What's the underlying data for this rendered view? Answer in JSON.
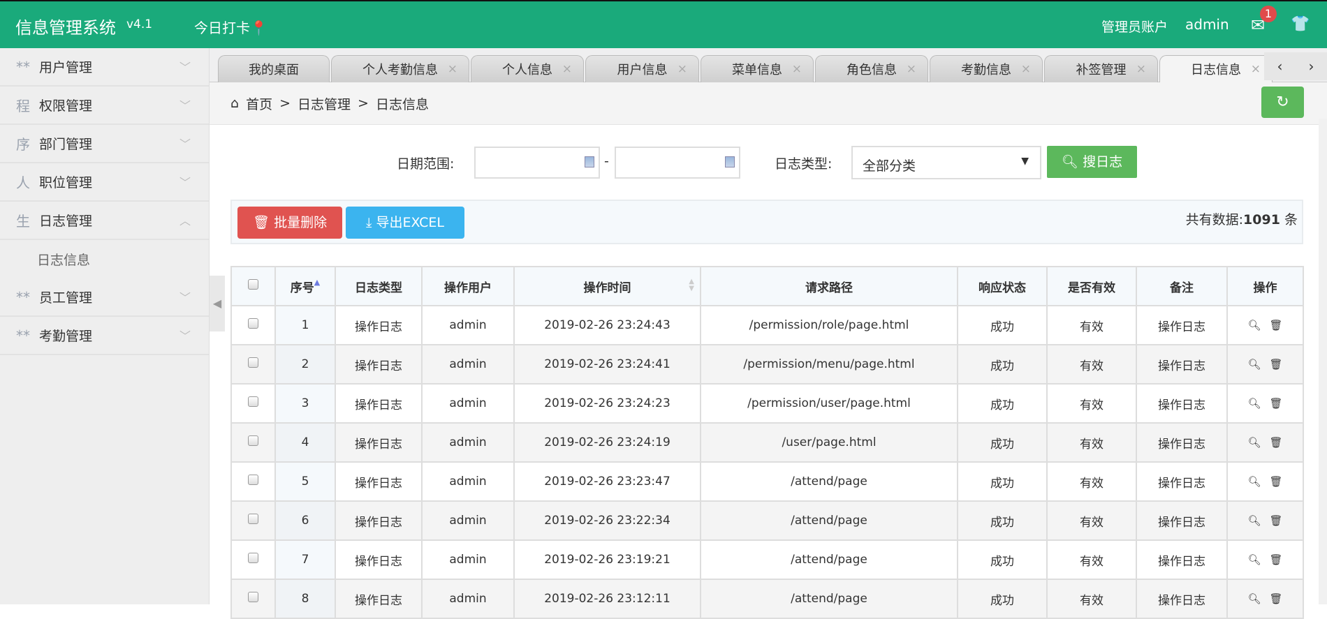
{
  "header": {
    "title": "信息管理系统",
    "version": "v4.1",
    "punch": "今日打卡",
    "account_label": "管理员账户",
    "username": "admin",
    "mail_badge": "1"
  },
  "sidebar": {
    "items": [
      {
        "icon": "**",
        "label": "用户管理",
        "chevron": "﹀"
      },
      {
        "icon": "程",
        "label": "权限管理",
        "chevron": "﹀"
      },
      {
        "icon": "序",
        "label": "部门管理",
        "chevron": "﹀"
      },
      {
        "icon": "人",
        "label": "职位管理",
        "chevron": "﹀"
      },
      {
        "icon": "生",
        "label": "日志管理",
        "chevron": "︿"
      }
    ],
    "sub": "日志信息",
    "items2": [
      {
        "icon": "**",
        "label": "员工管理",
        "chevron": "﹀"
      },
      {
        "icon": "**",
        "label": "考勤管理",
        "chevron": "﹀"
      }
    ]
  },
  "tabs": [
    "我的桌面",
    "个人考勤信息",
    "个人信息",
    "用户信息",
    "菜单信息",
    "角色信息",
    "考勤信息",
    "补签管理",
    "日志信息"
  ],
  "breadcrumb": [
    "首页",
    ">",
    "日志管理",
    ">",
    "日志信息"
  ],
  "search": {
    "date_label": "日期范围:",
    "date_sep": "-",
    "type_label": "日志类型:",
    "type_value": "全部分类",
    "button": "搜日志"
  },
  "toolbar": {
    "delete": "批量删除",
    "export": "导出EXCEL",
    "total_prefix": "共有数据:",
    "total": "1091",
    "total_suffix": "条"
  },
  "table": {
    "headers": [
      "序号",
      "日志类型",
      "操作用户",
      "操作时间",
      "请求路径",
      "响应状态",
      "是否有效",
      "备注",
      "操作"
    ],
    "rows": [
      [
        "1",
        "操作日志",
        "admin",
        "2019-02-26 23:24:43",
        "/permission/role/page.html",
        "成功",
        "有效",
        "操作日志"
      ],
      [
        "2",
        "操作日志",
        "admin",
        "2019-02-26 23:24:41",
        "/permission/menu/page.html",
        "成功",
        "有效",
        "操作日志"
      ],
      [
        "3",
        "操作日志",
        "admin",
        "2019-02-26 23:24:23",
        "/permission/user/page.html",
        "成功",
        "有效",
        "操作日志"
      ],
      [
        "4",
        "操作日志",
        "admin",
        "2019-02-26 23:24:19",
        "/user/page.html",
        "成功",
        "有效",
        "操作日志"
      ],
      [
        "5",
        "操作日志",
        "admin",
        "2019-02-26 23:23:47",
        "/attend/page",
        "成功",
        "有效",
        "操作日志"
      ],
      [
        "6",
        "操作日志",
        "admin",
        "2019-02-26 23:22:34",
        "/attend/page",
        "成功",
        "有效",
        "操作日志"
      ],
      [
        "7",
        "操作日志",
        "admin",
        "2019-02-26 23:19:21",
        "/attend/page",
        "成功",
        "有效",
        "操作日志"
      ],
      [
        "8",
        "操作日志",
        "admin",
        "2019-02-26 23:12:11",
        "/attend/page",
        "成功",
        "有效",
        "操作日志"
      ]
    ]
  },
  "colors": {
    "header": "#1aaa7b",
    "danger": "#e05350",
    "info": "#3bb4ef",
    "success": "#5cb85c"
  }
}
